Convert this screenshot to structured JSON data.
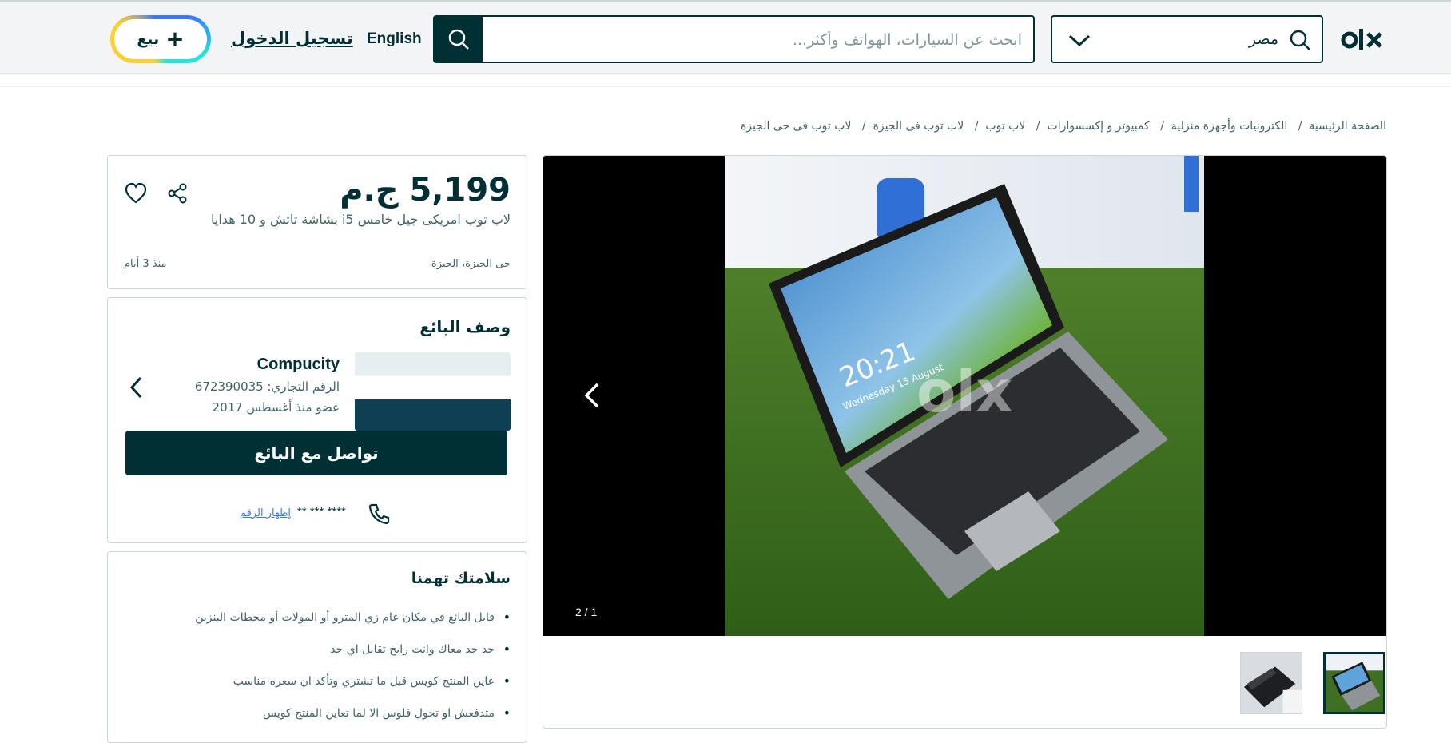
{
  "header": {
    "location": "مصر",
    "search_placeholder": "ابحث عن السيارات، الهواتف وأكثر...",
    "language": "English",
    "login": "تسجيل الدخول",
    "sell": "بيع"
  },
  "breadcrumb": [
    "الصفحة الرئيسية",
    "الكترونيات وأجهزة منزلية",
    "كمبيوتر و إكسسوارات",
    "لاب توب",
    "لاب توب فى الجيزة",
    "لاب توب فى حى الجيزة"
  ],
  "listing": {
    "price": "5,199 ج.م",
    "title": "لاب توب امريكى جيل خامس i5 بشاشة تاتش و 10 هدايا",
    "location": "حى الجيزة، الجيزة",
    "posted": "منذ 3 أيام"
  },
  "gallery": {
    "counter": "2 / 1",
    "watermark": "olx",
    "screen_time": "20:21",
    "screen_date": "Wednesday 15 August"
  },
  "seller": {
    "heading": "وصف البائع",
    "name": "Compucity",
    "registration": "الرقم التجاري: 672390035",
    "member_since": "عضو منذ أغسطس 2017",
    "contact_button": "تواصل مع البائع",
    "masked_phone": "** *** ****",
    "show_number": "إظهار الرقم"
  },
  "safety": {
    "heading": "سلامتك تهمنا",
    "tips": [
      "قابل البائع في مكان عام زي المترو أو المولات أو محطات البنزين",
      "خد حد معاك وانت رايح تقابل اي حد",
      "عاين المنتج كويس قبل ما تشتري وتأكد ان سعره مناسب",
      "متدفعش او تحول فلوس الا لما تعاين المنتج كويس"
    ]
  },
  "colors": {
    "brand": "#002f34",
    "accent_blue": "#3a77ff",
    "accent_yellow": "#ffce32",
    "accent_teal": "#23e5db"
  }
}
